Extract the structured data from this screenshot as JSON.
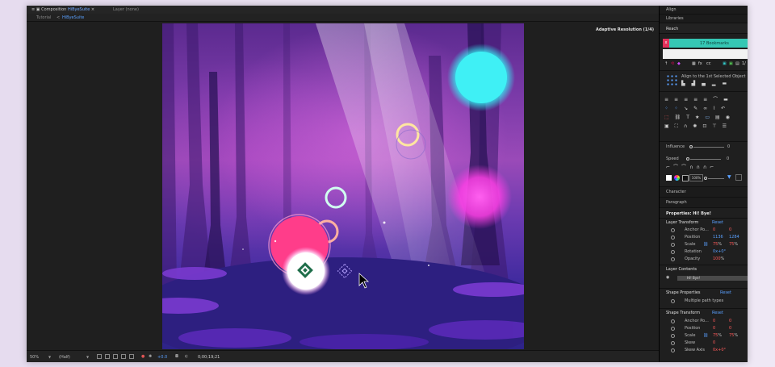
{
  "window": {
    "tab_title": "Composition",
    "tab_name": "HiByeSuite",
    "tab_close": "×",
    "layer_tab": "Layer (none)"
  },
  "breadcrumb": {
    "item1": "Tutorial",
    "separator": "<",
    "item2": "HiByeSuite"
  },
  "viewer": {
    "resolution_label": "Adaptive Resolution (1/4)"
  },
  "bottombar": {
    "zoom": "50%",
    "resolution": "(Half)",
    "exposure": "+0.0",
    "timecode": "0;00;19;21"
  },
  "panel": {
    "align": "Align",
    "libraries": "Libraries",
    "reach": "Reach",
    "bookmarks_close": "x",
    "bookmarks_label": "17 Bookmarks",
    "align_to": "Align to the 1st Selected Object",
    "influence": "Influence",
    "influence_val": "0",
    "speed": "Speed",
    "speed_val": "0",
    "pct": "100%",
    "character": "Character",
    "paragraph": "Paragraph",
    "properties_title": "Properties: Hi! Bye!",
    "layer_transform": "Layer Transform",
    "reset1": "Reset",
    "anchor": "Anchor Po...",
    "anchor_x": "0",
    "anchor_y": "0",
    "position": "Position",
    "position_x": "1136",
    "position_y": "1284",
    "scale": "Scale",
    "scale_x": "75",
    "scale_y": "75",
    "pct_sign": "%",
    "rotation": "Rotation",
    "rotation_val": "0x+0°",
    "opacity": "Opacity",
    "opacity_val": "100",
    "layer_contents": "Layer Contents",
    "layer_item": "Hi! Bye!",
    "shape_props": "Shape Properties",
    "reset2": "Reset",
    "multiple_path": "Multiple path types",
    "shape_transform": "Shape Transform",
    "reset3": "Reset",
    "s_anchor": "Anchor Po...",
    "s_anchor_x": "0",
    "s_anchor_y": "0",
    "s_position": "Position",
    "s_position_x": "0",
    "s_position_y": "0",
    "s_scale": "Scale",
    "s_scale_x": "75",
    "s_scale_y": "75",
    "s_skew": "Skew",
    "s_skew_val": "0",
    "s_skew_axis": "Skew Axis",
    "s_skew_axis_val": "0x+0°"
  },
  "colors": {
    "accent_blue": "#5aa0ff",
    "bookmarks": "#35c7b4",
    "close_red": "#e0305a"
  }
}
